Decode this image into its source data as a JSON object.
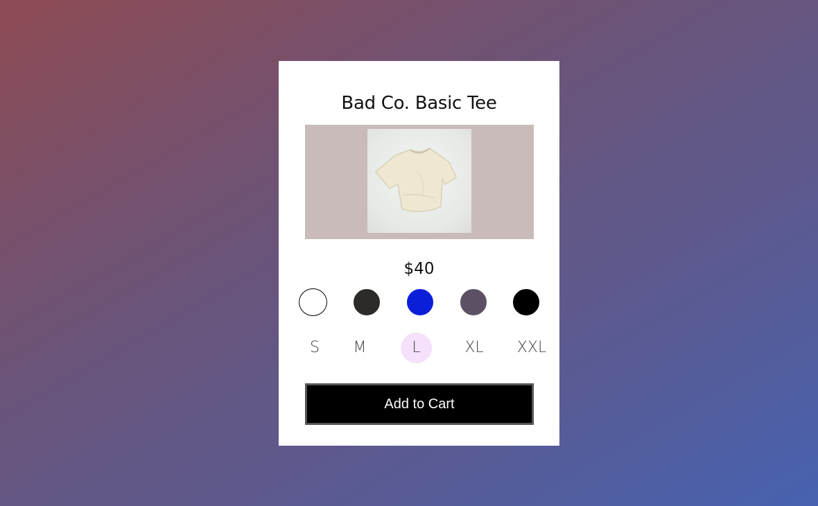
{
  "product": {
    "title": "Bad Co. Basic Tee",
    "price": "$40",
    "image_icon": "t-shirt-photo"
  },
  "colors": [
    {
      "name": "white",
      "hex": "#ffffff",
      "border": "#000000"
    },
    {
      "name": "charcoal",
      "hex": "#2c2b29",
      "border": "#2c2b29"
    },
    {
      "name": "blue",
      "hex": "#0b1fd9",
      "border": "#0b1fd9"
    },
    {
      "name": "slate",
      "hex": "#5c5064",
      "border": "#5c5064"
    },
    {
      "name": "black",
      "hex": "#000000",
      "border": "#000000"
    }
  ],
  "sizes": [
    {
      "label": "S",
      "selected": false
    },
    {
      "label": "M",
      "selected": false
    },
    {
      "label": "L",
      "selected": true
    },
    {
      "label": "XL",
      "selected": false
    },
    {
      "label": "XXL",
      "selected": false
    }
  ],
  "selected_size_color": "#f5e1fb",
  "cart_button": {
    "label": "Add to Cart"
  }
}
